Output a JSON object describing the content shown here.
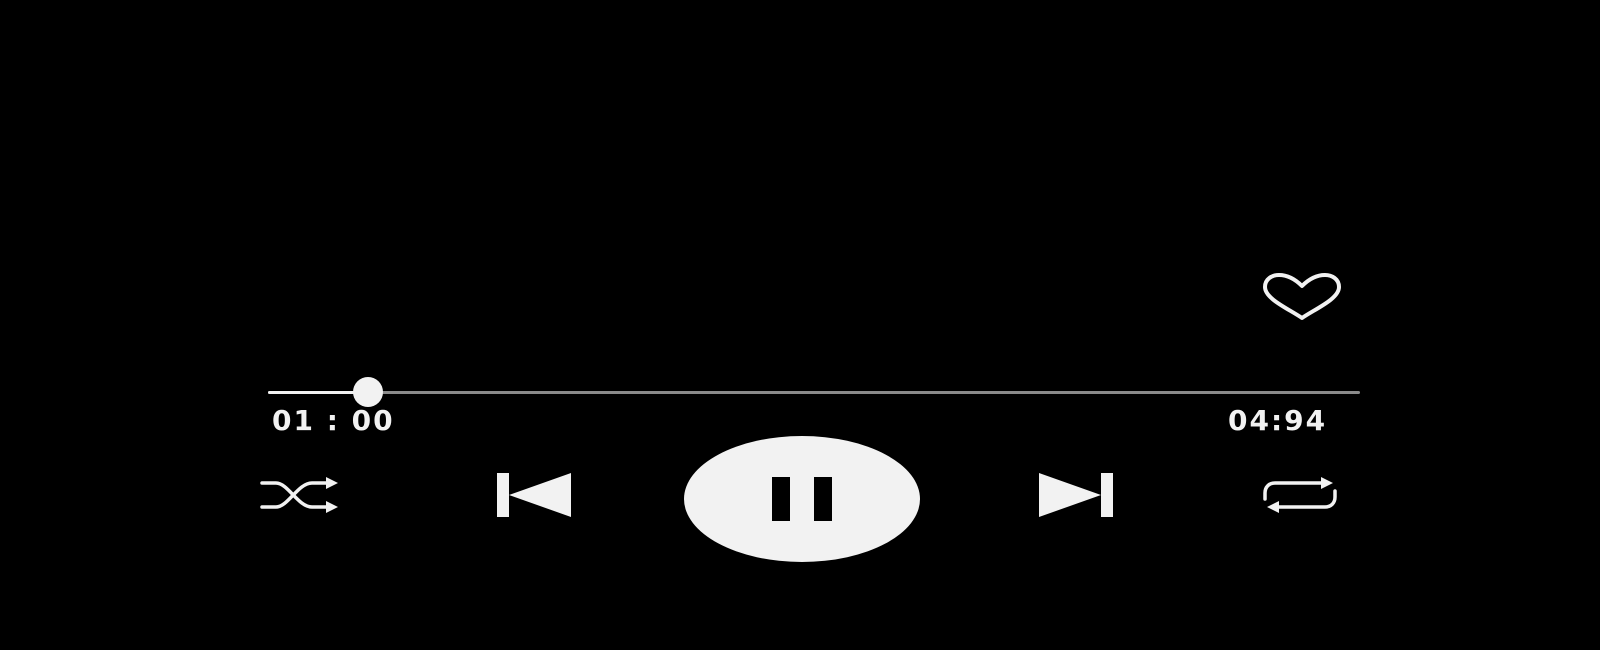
{
  "player": {
    "progress": {
      "elapsed": "01 : 00",
      "total": "04:94",
      "fraction": 0.092
    },
    "icons": {
      "like": "heart-outline-icon",
      "shuffle": "shuffle-icon",
      "previous": "skip-previous-icon",
      "play_pause": "pause-icon",
      "next": "skip-next-icon",
      "repeat": "repeat-icon"
    },
    "colors": {
      "background": "#000000",
      "foreground": "#f2f2f2",
      "track": "#8a8a8a"
    }
  }
}
